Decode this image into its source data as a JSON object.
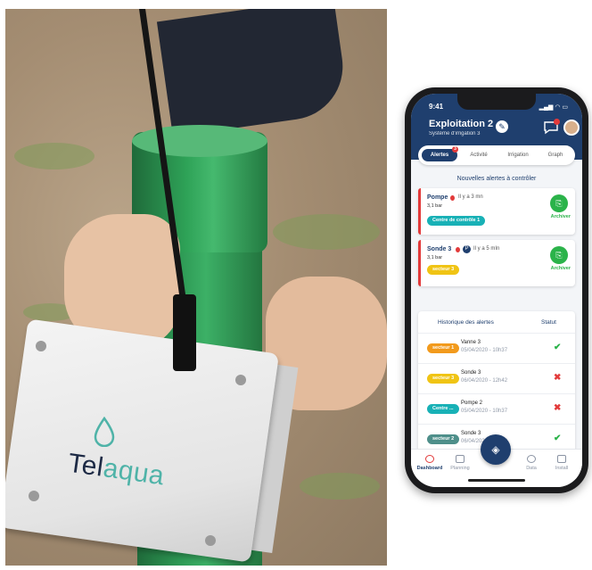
{
  "product": {
    "brand_part1": "Tel",
    "brand_part2": "aqua"
  },
  "app": {
    "time": "9:41",
    "title": "Exploitation 2",
    "subtitle": "Système d'irrigation 3",
    "tabs": [
      {
        "label": "Alertes",
        "active": true,
        "badge": "3"
      },
      {
        "label": "Activité",
        "active": false
      },
      {
        "label": "Irrigation",
        "active": false
      },
      {
        "label": "Graph",
        "active": false
      }
    ],
    "new_alerts_title": "Nouvelles alertes à contrôler",
    "new_alerts": [
      {
        "name": "Pompe",
        "time": "Il y a 3 mn",
        "value": "3,1 bar",
        "tag": "Centre de contrôle 1",
        "tag_color": "#18b1b6",
        "archive_label": "Archiver"
      },
      {
        "name": "Sonde 3",
        "badge": "P",
        "time": "Il y a 5 mIn",
        "value": "3,1 bar",
        "tag": "secteur 3",
        "tag_color": "#f0c414",
        "archive_label": "Archiver"
      }
    ],
    "history": {
      "title": "Historique des alertes",
      "status_header": "Statut",
      "rows": [
        {
          "tag": "secteur 1",
          "tag_color": "#f29a1c",
          "name": "Vanne 3",
          "date": "05/04/2020 - 10h37",
          "status": "✔",
          "status_color": "#2bb34a"
        },
        {
          "tag": "secteur 3",
          "tag_color": "#f0c414",
          "name": "Sonde 3",
          "date": "06/04/2020 - 12h42",
          "status": "✖",
          "status_color": "#e23a3a"
        },
        {
          "tag": "Centre ...",
          "tag_color": "#18b1b6",
          "name": "Pompe 2",
          "date": "05/04/2020 - 10h37",
          "status": "✖",
          "status_color": "#e23a3a"
        },
        {
          "tag": "secteur 2",
          "tag_color": "#4e8f8a",
          "name": "Sonde 3",
          "date": "06/04/2020 - 12h42",
          "status": "✔",
          "status_color": "#2bb34a"
        }
      ]
    },
    "nav": [
      {
        "label": "Dashboard",
        "active": true
      },
      {
        "label": "Planning",
        "active": false
      },
      {
        "label": "Data",
        "active": false
      },
      {
        "label": "Install",
        "active": false
      }
    ]
  }
}
